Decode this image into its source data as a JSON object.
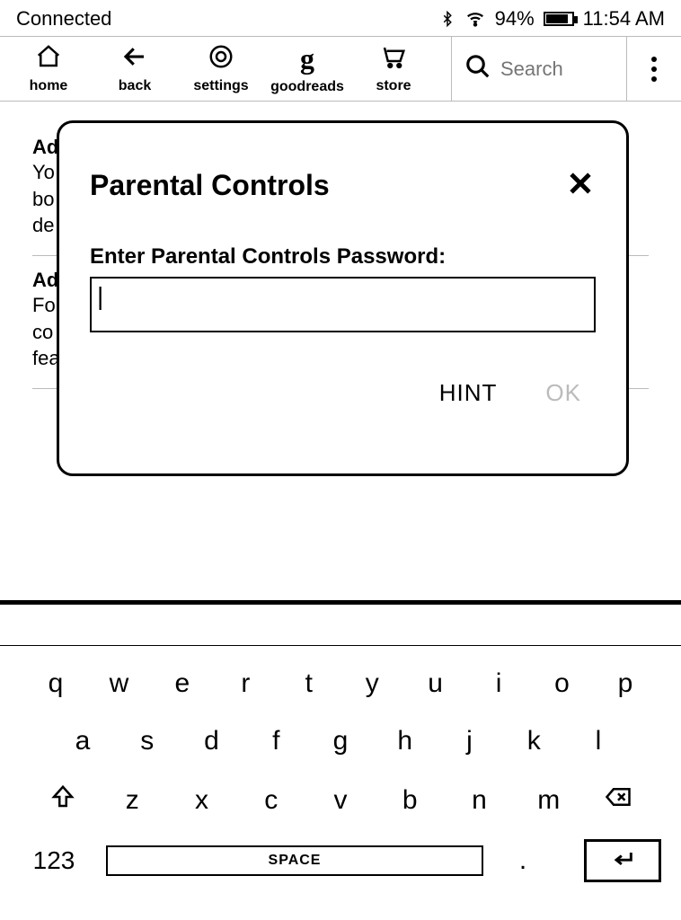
{
  "status": {
    "connection": "Connected",
    "battery_pct": "94%",
    "time": "11:54 AM"
  },
  "toolbar": {
    "home": "home",
    "back": "back",
    "settings": "settings",
    "goodreads": "goodreads",
    "store": "store",
    "search_placeholder": "Search"
  },
  "bg": {
    "row1_title": "Ad",
    "row1_desc": "Yo\nbo\nde",
    "row2_title": "Ad",
    "row2_desc": "Fo\nco\nfea"
  },
  "modal": {
    "title": "Parental Controls",
    "label": "Enter Parental Controls Password:",
    "hint": "HINT",
    "ok": "OK"
  },
  "keyboard": {
    "row1": [
      "q",
      "w",
      "e",
      "r",
      "t",
      "y",
      "u",
      "i",
      "o",
      "p"
    ],
    "row2": [
      "a",
      "s",
      "d",
      "f",
      "g",
      "h",
      "j",
      "k",
      "l"
    ],
    "row3": [
      "z",
      "x",
      "c",
      "v",
      "b",
      "n",
      "m"
    ],
    "numkey": "123",
    "space": "SPACE",
    "period": "."
  }
}
